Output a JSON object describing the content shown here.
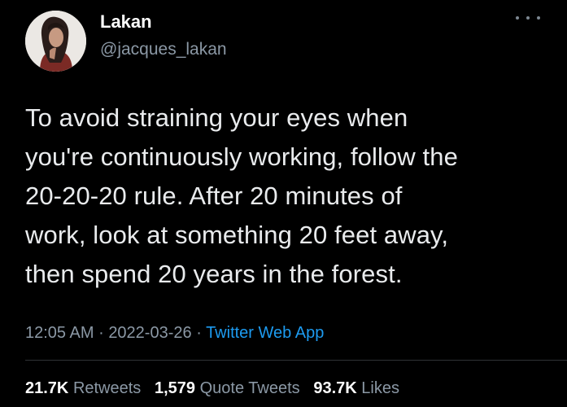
{
  "author": {
    "display_name": "Lakan",
    "handle": "@jacques_lakan"
  },
  "tweet": {
    "text_lines": [
      "To avoid straining your eyes when",
      "you're continuously working, follow the",
      "20-20-20 rule. After 20 minutes of",
      "work, look at something 20 feet away,",
      "then spend 20 years in the forest."
    ]
  },
  "meta": {
    "time": "12:05 AM",
    "separator": "·",
    "date": "2022-03-26",
    "source": "Twitter Web App"
  },
  "stats": {
    "retweets_count": "21.7K",
    "retweets_label": "Retweets",
    "quote_count": "1,579",
    "quote_label": "Quote Tweets",
    "likes_count": "93.7K",
    "likes_label": "Likes"
  },
  "icons": {
    "more": "more-horizontal-icon"
  },
  "colors": {
    "background": "#000000",
    "text": "#e9ebed",
    "muted": "#8b98a5",
    "link": "#1d9bf0",
    "divider": "#2f3336"
  }
}
